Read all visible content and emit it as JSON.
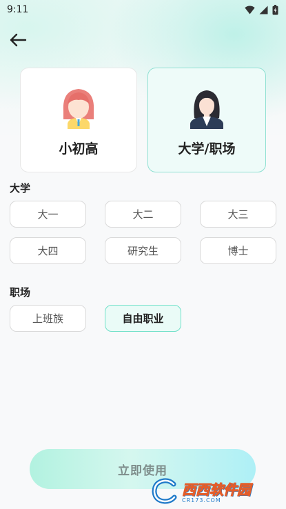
{
  "status_bar": {
    "time": "9:11",
    "icons": [
      "wifi-icon",
      "signal-icon",
      "battery-charging-icon"
    ]
  },
  "nav": {
    "back_icon": "arrow-left-icon"
  },
  "levels": {
    "left": {
      "label": "小初高",
      "avatar": "girl-avatar-icon",
      "selected": false
    },
    "right": {
      "label": "大学/职场",
      "avatar": "professional-woman-avatar-icon",
      "selected": true
    }
  },
  "university": {
    "title": "大学",
    "options": [
      "大一",
      "大二",
      "大三",
      "大四",
      "研究生",
      "博士"
    ]
  },
  "workplace": {
    "title": "职场",
    "options": [
      "上班族",
      "自由职业"
    ],
    "selected": "自由职业"
  },
  "action": {
    "label": "立即使用"
  },
  "watermark": {
    "brand": "西西软件园",
    "domain": "CR173.COM"
  },
  "colors": {
    "accent_border": "#8fe0d2",
    "selected_chip_bg": "#eafbf7",
    "button_gradient_start": "#b2f2e0",
    "button_gradient_end": "#aef0f6"
  }
}
